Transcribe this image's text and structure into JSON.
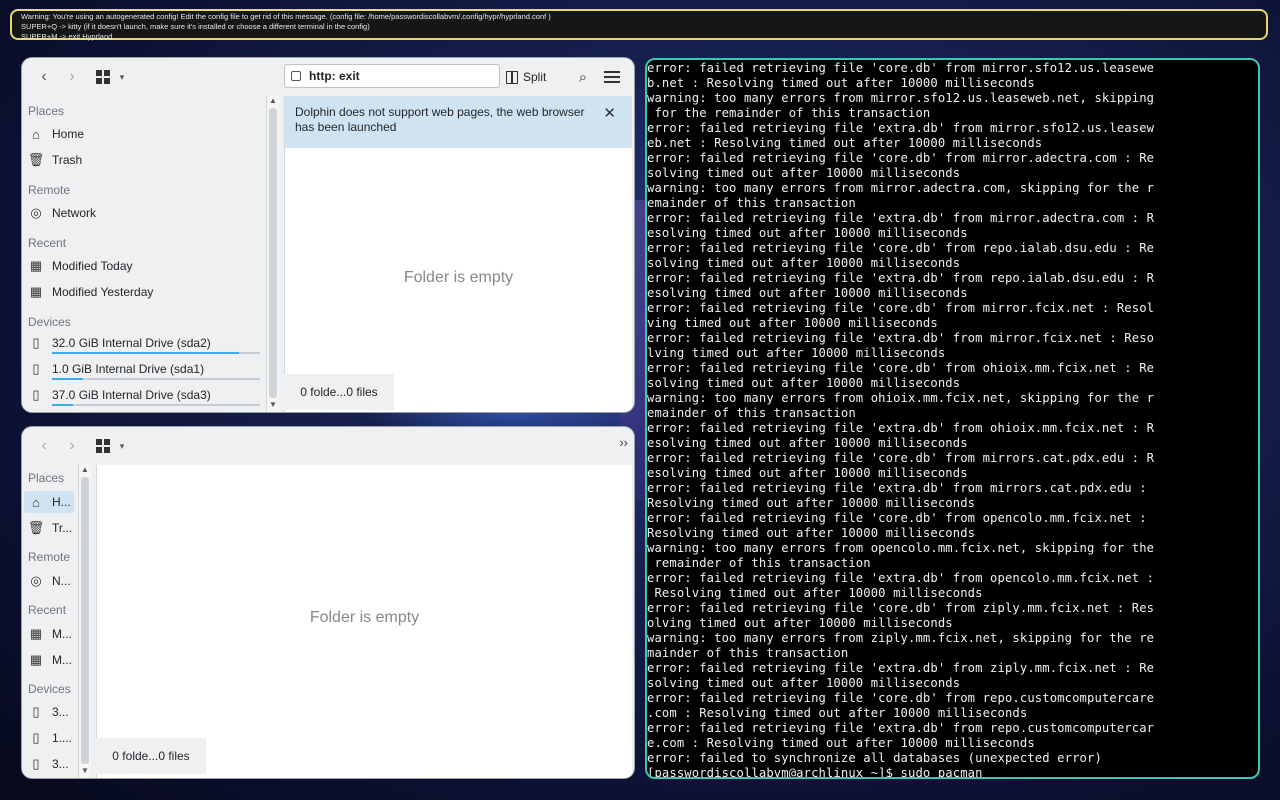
{
  "warning": {
    "lines": [
      "Warning: You're using an autogenerated config! Edit the config file to get rid of this message. (config file: /home/passwordiscollabvm/.config/hypr/hyprland.conf )",
      "SUPER+Q -> kitty (if it doesn't launch, make sure it's installed or choose a different terminal in the config)",
      "SUPER+M -> exit Hyprland"
    ]
  },
  "dolphin_top": {
    "address": "http: exit",
    "split_label": "Split",
    "banner_text": "Dolphin does not support web pages, the web browser has been launched",
    "empty_text": "Folder is empty",
    "status": "0 folde...0 files",
    "places": {
      "sections": [
        "Places",
        "Remote",
        "Recent",
        "Devices"
      ],
      "items": [
        {
          "label": "Home",
          "icon": "home-icon"
        },
        {
          "label": "Trash",
          "icon": "trash-icon"
        },
        {
          "label": "Network",
          "icon": "network-icon"
        },
        {
          "label": "Modified Today",
          "icon": "calendar-icon"
        },
        {
          "label": "Modified Yesterday",
          "icon": "calendar-icon"
        },
        {
          "label": "32.0 GiB Internal Drive (sda2)",
          "icon": "drive-icon",
          "usage": 0.9
        },
        {
          "label": "1.0 GiB Internal Drive (sda1)",
          "icon": "drive-icon",
          "usage": 0.15
        },
        {
          "label": "37.0 GiB Internal Drive (sda3)",
          "icon": "drive-icon",
          "usage": 0.1
        }
      ]
    }
  },
  "dolphin_bottom": {
    "empty_text": "Folder is empty",
    "status": "0 folde...0 files",
    "places": {
      "sections": [
        "Places",
        "Remote",
        "Recent",
        "Devices"
      ],
      "items": [
        {
          "label": "H...",
          "icon": "home-icon"
        },
        {
          "label": "Tr...",
          "icon": "trash-icon"
        },
        {
          "label": "N...",
          "icon": "network-icon"
        },
        {
          "label": "M...",
          "icon": "calendar-icon"
        },
        {
          "label": "M...",
          "icon": "calendar-icon"
        },
        {
          "label": "3...",
          "icon": "drive-icon"
        },
        {
          "label": "1....",
          "icon": "drive-icon"
        },
        {
          "label": "3...",
          "icon": "drive-icon"
        }
      ]
    }
  },
  "terminal": {
    "lines": [
      "error: failed retrieving file 'core.db' from mirror.sfo12.us.leasewe",
      "b.net : Resolving timed out after 10000 milliseconds",
      "warning: too many errors from mirror.sfo12.us.leaseweb.net, skipping",
      " for the remainder of this transaction",
      "error: failed retrieving file 'extra.db' from mirror.sfo12.us.leasew",
      "eb.net : Resolving timed out after 10000 milliseconds",
      "error: failed retrieving file 'core.db' from mirror.adectra.com : Re",
      "solving timed out after 10000 milliseconds",
      "warning: too many errors from mirror.adectra.com, skipping for the r",
      "emainder of this transaction",
      "error: failed retrieving file 'extra.db' from mirror.adectra.com : R",
      "esolving timed out after 10000 milliseconds",
      "error: failed retrieving file 'core.db' from repo.ialab.dsu.edu : Re",
      "solving timed out after 10000 milliseconds",
      "error: failed retrieving file 'extra.db' from repo.ialab.dsu.edu : R",
      "esolving timed out after 10000 milliseconds",
      "error: failed retrieving file 'core.db' from mirror.fcix.net : Resol",
      "ving timed out after 10000 milliseconds",
      "error: failed retrieving file 'extra.db' from mirror.fcix.net : Reso",
      "lving timed out after 10000 milliseconds",
      "error: failed retrieving file 'core.db' from ohioix.mm.fcix.net : Re",
      "solving timed out after 10000 milliseconds",
      "warning: too many errors from ohioix.mm.fcix.net, skipping for the r",
      "emainder of this transaction",
      "error: failed retrieving file 'extra.db' from ohioix.mm.fcix.net : R",
      "esolving timed out after 10000 milliseconds",
      "error: failed retrieving file 'core.db' from mirrors.cat.pdx.edu : R",
      "esolving timed out after 10000 milliseconds",
      "error: failed retrieving file 'extra.db' from mirrors.cat.pdx.edu :",
      "Resolving timed out after 10000 milliseconds",
      "error: failed retrieving file 'core.db' from opencolo.mm.fcix.net :",
      "Resolving timed out after 10000 milliseconds",
      "warning: too many errors from opencolo.mm.fcix.net, skipping for the",
      " remainder of this transaction",
      "error: failed retrieving file 'extra.db' from opencolo.mm.fcix.net :",
      " Resolving timed out after 10000 milliseconds",
      "error: failed retrieving file 'core.db' from ziply.mm.fcix.net : Res",
      "olving timed out after 10000 milliseconds",
      "warning: too many errors from ziply.mm.fcix.net, skipping for the re",
      "mainder of this transaction",
      "error: failed retrieving file 'extra.db' from ziply.mm.fcix.net : Re",
      "solving timed out after 10000 milliseconds",
      "error: failed retrieving file 'core.db' from repo.customcomputercare",
      ".com : Resolving timed out after 10000 milliseconds",
      "error: failed retrieving file 'extra.db' from repo.customcomputercar",
      "e.com : Resolving timed out after 10000 milliseconds",
      "error: failed to synchronize all databases (unexpected error)",
      "[passwordiscollabvm@archlinux ~]$ sudo pacman"
    ]
  },
  "colors": {
    "warning_border": "#e4d96a",
    "terminal_border": "#3ac7b0",
    "banner_bg": "#cfe3f3",
    "accent": "#3daee9"
  }
}
